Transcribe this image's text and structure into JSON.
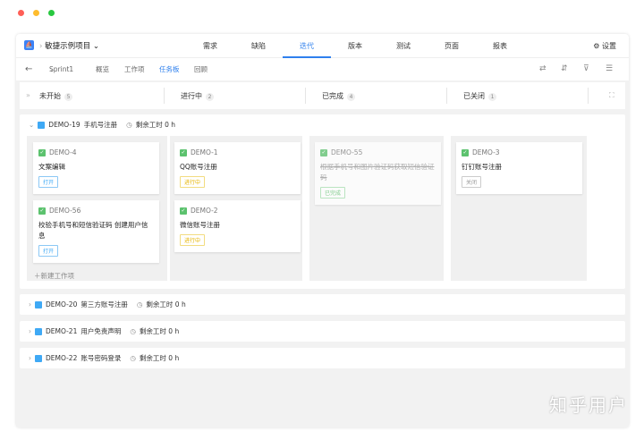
{
  "window": {
    "dots": [
      "#ff5f57",
      "#febc2e",
      "#28c840"
    ]
  },
  "header": {
    "project": "敏捷示例项目",
    "tabs": [
      "需求",
      "缺陷",
      "迭代",
      "版本",
      "测试",
      "页面",
      "报表"
    ],
    "active_tab": 2,
    "settings": "设置"
  },
  "subnav": {
    "sprint": "Sprint1",
    "items": [
      "概览",
      "工作项",
      "任务板",
      "回顾"
    ],
    "active": 2
  },
  "columns": [
    {
      "label": "未开始",
      "count": "5"
    },
    {
      "label": "进行中",
      "count": "2"
    },
    {
      "label": "已完成",
      "count": "4"
    },
    {
      "label": "已关闭",
      "count": "1"
    }
  ],
  "swimlane": {
    "id": "DEMO-19",
    "title": "手机号注册",
    "remaining": "剩余工时 0 h",
    "new_item": "新建工作项",
    "cards": {
      "c1a": {
        "id": "DEMO-4",
        "title": "文案编辑",
        "status": "打开"
      },
      "c1b": {
        "id": "DEMO-56",
        "title": "校验手机号和短信验证码 创建用户信息",
        "status": "打开"
      },
      "c2a": {
        "id": "DEMO-1",
        "title": "QQ账号注册",
        "status": "进行中"
      },
      "c2b": {
        "id": "DEMO-2",
        "title": "微信账号注册",
        "status": "进行中"
      },
      "c3a": {
        "id": "DEMO-55",
        "title": "根据手机号和图片验证码获取短信验证码",
        "status": "已完成"
      },
      "c4a": {
        "id": "DEMO-3",
        "title": "钉钉账号注册",
        "status": "关闭"
      }
    }
  },
  "collapsed": [
    {
      "id": "DEMO-20",
      "title": "第三方账号注册",
      "remaining": "剩余工时 0 h"
    },
    {
      "id": "DEMO-21",
      "title": "用户免责声明",
      "remaining": "剩余工时 0 h"
    },
    {
      "id": "DEMO-22",
      "title": "账号密码登录",
      "remaining": "剩余工时 0 h"
    }
  ],
  "watermark": "知乎用户"
}
